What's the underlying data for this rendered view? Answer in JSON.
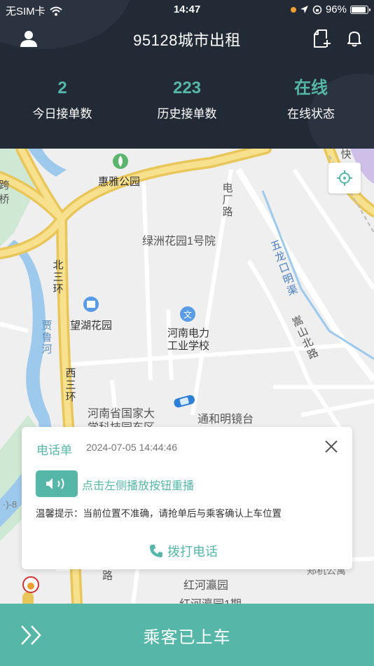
{
  "status_bar": {
    "carrier": "无SIM卡",
    "time": "14:47",
    "battery": "96%"
  },
  "header": {
    "title": "95128城市出租",
    "stats": [
      {
        "value": "2",
        "label": "今日接单数"
      },
      {
        "value": "223",
        "label": "历史接单数"
      },
      {
        "value": "在线",
        "label": "在线状态"
      }
    ]
  },
  "map": {
    "labels": {
      "huiya_park": "惠雅公园",
      "lvzhou": "绿洲花园1号院",
      "wanghu": "望湖花园",
      "henan_school": "河南电力\n工业学校",
      "guojia_park": "河南省国家大",
      "guojia_park2": "学科技园东区",
      "tonghe": "通和明镜台",
      "honghe": "红河瀛园",
      "honghe2": "红河瀛园1期",
      "zhengji": "郑机公寓",
      "dianchang_road": "电厂路",
      "bei_sanhuan": "北三环",
      "xi_sanhuan": "西三环",
      "jialu_river": "贾鲁河",
      "wulongkou": "五龙口明渠",
      "songshan": "嵩山北路",
      "kua": "跨",
      "qiao": "桥",
      "kuai": "快",
      "lu": "路",
      "misc": "·)-8"
    }
  },
  "order_card": {
    "type": "电话单",
    "time": "2024-07-05 14:44:46",
    "replay_hint": "点击左侧播放按钮重播",
    "tip": "温馨提示：当前位置不准确，请抢单后与乘客确认上车位置",
    "call_label": "拨打电话"
  },
  "bottom_action": {
    "label": "乘客已上车"
  },
  "colors": {
    "accent": "#56b7a8",
    "header_bg": "#222a35"
  }
}
